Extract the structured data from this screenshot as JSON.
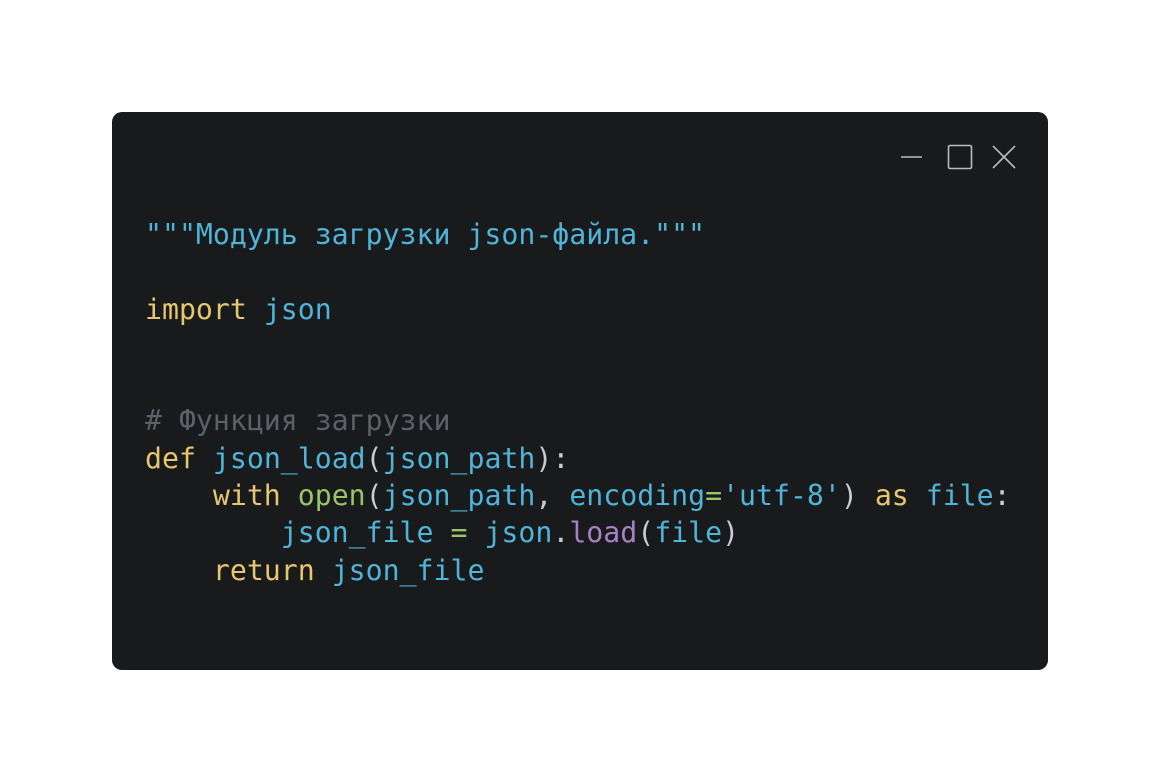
{
  "window_controls": {
    "minimize": "minimize-icon",
    "maximize": "maximize-icon",
    "close": "close-icon"
  },
  "colors": {
    "background": "#181a1c",
    "docstring": "#4fb4d8",
    "keyword": "#e6c770",
    "identifier": "#4fb4d8",
    "comment": "#5b6168",
    "punctuation": "#c8ccd0",
    "builtin": "#9ac46a",
    "method": "#a980c8",
    "string": "#4fb4d8",
    "operator": "#9ac46a"
  },
  "code": {
    "lines": [
      [
        {
          "text": "\"\"\"Модуль загрузки json-файла.\"\"\"",
          "kind": "docstring"
        }
      ],
      [],
      [
        {
          "text": "import",
          "kind": "keyword"
        },
        {
          "text": " ",
          "kind": "punctuation"
        },
        {
          "text": "json",
          "kind": "identifier"
        }
      ],
      [],
      [],
      [
        {
          "text": "# Функция загрузки",
          "kind": "comment"
        }
      ],
      [
        {
          "text": "def",
          "kind": "keyword"
        },
        {
          "text": " ",
          "kind": "punctuation"
        },
        {
          "text": "json_load",
          "kind": "identifier"
        },
        {
          "text": "(",
          "kind": "punctuation"
        },
        {
          "text": "json_path",
          "kind": "identifier"
        },
        {
          "text": "):",
          "kind": "punctuation"
        }
      ],
      [
        {
          "text": "    ",
          "kind": "punctuation"
        },
        {
          "text": "with",
          "kind": "keyword"
        },
        {
          "text": " ",
          "kind": "punctuation"
        },
        {
          "text": "open",
          "kind": "builtin"
        },
        {
          "text": "(",
          "kind": "punctuation"
        },
        {
          "text": "json_path",
          "kind": "identifier"
        },
        {
          "text": ", ",
          "kind": "punctuation"
        },
        {
          "text": "encoding",
          "kind": "identifier"
        },
        {
          "text": "=",
          "kind": "operator"
        },
        {
          "text": "'utf-8'",
          "kind": "string"
        },
        {
          "text": ") ",
          "kind": "punctuation"
        },
        {
          "text": "as",
          "kind": "keyword"
        },
        {
          "text": " ",
          "kind": "punctuation"
        },
        {
          "text": "file",
          "kind": "identifier"
        },
        {
          "text": ":",
          "kind": "punctuation"
        }
      ],
      [
        {
          "text": "        ",
          "kind": "punctuation"
        },
        {
          "text": "json_file",
          "kind": "identifier"
        },
        {
          "text": " ",
          "kind": "punctuation"
        },
        {
          "text": "=",
          "kind": "operator"
        },
        {
          "text": " ",
          "kind": "punctuation"
        },
        {
          "text": "json",
          "kind": "identifier"
        },
        {
          "text": ".",
          "kind": "punctuation"
        },
        {
          "text": "load",
          "kind": "method"
        },
        {
          "text": "(",
          "kind": "punctuation"
        },
        {
          "text": "file",
          "kind": "identifier"
        },
        {
          "text": ")",
          "kind": "punctuation"
        }
      ],
      [
        {
          "text": "    ",
          "kind": "punctuation"
        },
        {
          "text": "return",
          "kind": "keyword"
        },
        {
          "text": " ",
          "kind": "punctuation"
        },
        {
          "text": "json_file",
          "kind": "identifier"
        }
      ]
    ]
  }
}
